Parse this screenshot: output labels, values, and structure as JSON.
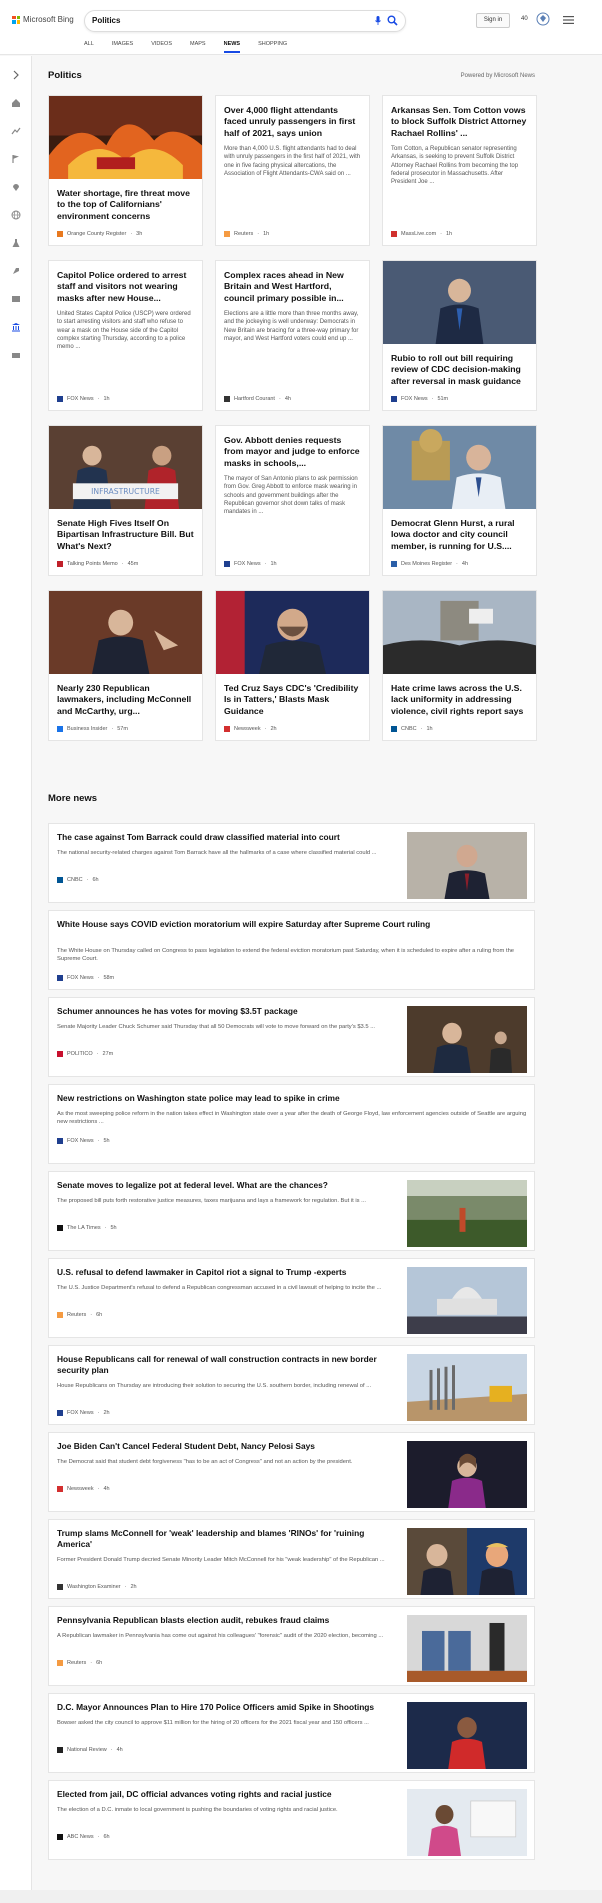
{
  "header": {
    "logo_text": "Microsoft Bing",
    "search_value": "Politics",
    "signin_label": "Sign in",
    "points": "40",
    "tabs": [
      {
        "label": "ALL"
      },
      {
        "label": "IMAGES"
      },
      {
        "label": "VIDEOS"
      },
      {
        "label": "MAPS"
      },
      {
        "label": "NEWS"
      },
      {
        "label": "SHOPPING"
      }
    ],
    "active_tab": "NEWS"
  },
  "rail_icons": [
    "collapse-arrow-icon",
    "home-icon",
    "trending-icon",
    "flag-icon",
    "location-pin-icon",
    "globe-icon",
    "science-icon",
    "rocket-icon",
    "film-icon",
    "politics-building-icon",
    "money-icon"
  ],
  "section": {
    "title": "Politics",
    "powered_by": "Powered by Microsoft News"
  },
  "cards": [
    {
      "title": "Water shortage, fire threat move to the top of Californians' environment concerns",
      "desc": "",
      "source": "Orange County Register",
      "time": "3h",
      "image": "wildfire",
      "source_color": "#e8791f"
    },
    {
      "title": "Over 4,000 flight attendants faced unruly passengers in first half of 2021, says union",
      "desc": "More than 4,000 U.S. flight attendants had to deal with unruly passengers in the first half of 2021, with one in five facing physical altercations, the Association of Flight Attendants-CWA said on ...",
      "source": "Reuters",
      "time": "1h",
      "image": "",
      "source_color": "#f59b42"
    },
    {
      "title": "Arkansas Sen. Tom Cotton vows to block Suffolk District Attorney Rachael Rollins' ...",
      "desc": "Tom Cotton, a Republican senator representing Arkansas, is seeking to prevent Suffolk District Attorney Rachael Rollins from becoming the top federal prosecutor in Massachusetts. After President Joe ...",
      "source": "MassLive.com",
      "time": "1h",
      "image": "",
      "source_color": "#d0312d"
    },
    {
      "title": "Capitol Police ordered to arrest staff and visitors not wearing masks after new House...",
      "desc": "United States Capitol Police (USCP) were ordered to start arresting visitors and staff who refuse to wear a mask on the House side of the Capitol complex starting Thursday, according to a police memo ...",
      "source": "FOX News",
      "time": "1h",
      "image": "",
      "source_color": "#1f3f8f"
    },
    {
      "title": "Complex races ahead in New Britain and West Hartford, council primary possible in...",
      "desc": "Elections are a little more than three months away, and the jockeying is well underway: Democrats in New Britain are bracing for a three-way primary for mayor, and West Hartford voters could end up ...",
      "source": "Hartford Courant",
      "time": "4h",
      "image": "",
      "source_color": "#333333"
    },
    {
      "title": "Rubio to roll out bill requiring review of CDC decision-making after reversal in mask guidance",
      "desc": "",
      "source": "FOX News",
      "time": "51m",
      "image": "rubio",
      "source_color": "#1f3f8f"
    },
    {
      "title": "Senate High Fives Itself On Bipartisan Infrastructure Bill. But What's Next?",
      "desc": "",
      "source": "Talking Points Memo",
      "time": "45m",
      "image": "infrastructure",
      "source_color": "#c0202a"
    },
    {
      "title": "Gov. Abbott denies requests from mayor and judge to enforce masks in schools,...",
      "desc": "The mayor of San Antonio plans to ask permission from Gov. Greg Abbott to enforce mask wearing in schools and government buildings after the Republican governor shot down talks of mask mandates in ...",
      "source": "FOX News",
      "time": "1h",
      "image": "",
      "source_color": "#1f3f8f"
    },
    {
      "title": "Democrat Glenn Hurst, a rural Iowa doctor and city council member, is running for U.S....",
      "desc": "",
      "source": "Des Moines Register",
      "time": "4h",
      "image": "hurst",
      "source_color": "#2a5fa8"
    },
    {
      "title": "Nearly 230 Republican lawmakers, including McConnell and McCarthy, urg...",
      "desc": "",
      "source": "Business Insider",
      "time": "57m",
      "image": "mcconnell",
      "source_color": "#1a73e8"
    },
    {
      "title": "Ted Cruz Says CDC's 'Credibility Is in Tatters,' Blasts Mask Guidance",
      "desc": "",
      "source": "Newsweek",
      "time": "2h",
      "image": "cruz",
      "source_color": "#d32f2f"
    },
    {
      "title": "Hate crime laws across the U.S. lack uniformity in addressing violence, civil rights report says",
      "desc": "",
      "source": "CNBC",
      "time": "1h",
      "image": "protest",
      "source_color": "#005594"
    }
  ],
  "more_news": {
    "title": "More news",
    "items": [
      {
        "title": "The case against Tom Barrack could draw classified material into court",
        "desc": "The national security-related charges against Tom Barrack have all the hallmarks of a case where classified material could ...",
        "source": "CNBC",
        "time": "6h",
        "image": "barrack",
        "source_color": "#005594"
      },
      {
        "title": "White House says COVID eviction moratorium will expire Saturday after Supreme Court ruling",
        "desc": "The White House on Thursday called on Congress to pass legislation to extend the federal eviction moratorium past Saturday, when it is scheduled to expire after a ruling from the Supreme Court.",
        "source": "FOX News",
        "time": "58m",
        "image": "",
        "source_color": "#1f3f8f"
      },
      {
        "title": "Schumer announces he has votes for moving $3.5T package",
        "desc": "Senate Majority Leader Chuck Schumer said Thursday that all 50 Democrats will vote to move forward on the party's $3.5 ...",
        "source": "POLITICO",
        "time": "27m",
        "image": "schumer",
        "source_color": "#c8102e"
      },
      {
        "title": "New restrictions on Washington state police may lead to spike in crime",
        "desc": "As the most sweeping police reform in the nation takes effect in Washington state over a year after the death of George Floyd, law enforcement agencies outside of Seattle are arguing new restrictions ...",
        "source": "FOX News",
        "time": "5h",
        "image": "",
        "source_color": "#1f3f8f"
      },
      {
        "title": "Senate moves to legalize pot at federal level. What are the chances?",
        "desc": "The proposed bill puts forth restorative justice measures, taxes marijuana and lays a framework for regulation. But it is ...",
        "source": "The LA Times",
        "time": "5h",
        "image": "greenhouse",
        "source_color": "#111111"
      },
      {
        "title": "U.S. refusal to defend lawmaker in Capitol riot a signal to Trump -experts",
        "desc": "The U.S. Justice Department's refusal to defend a Republican congressman accused in a civil lawsuit of helping to incite the ...",
        "source": "Reuters",
        "time": "6h",
        "image": "capitol",
        "source_color": "#f59b42"
      },
      {
        "title": "House Republicans call for renewal of wall construction contracts in new border security plan",
        "desc": "House Republicans on Thursday are introducing their solution to securing the U.S. southern border, including renewal of ...",
        "source": "FOX News",
        "time": "2h",
        "image": "wall",
        "source_color": "#1f3f8f"
      },
      {
        "title": "Joe Biden Can't Cancel Federal Student Debt, Nancy Pelosi Says",
        "desc": "The Democrat said that student debt forgiveness \"has to be an act of Congress\" and not an action by the president.",
        "source": "Newsweek",
        "time": "4h",
        "image": "pelosi",
        "source_color": "#d32f2f"
      },
      {
        "title": "Trump slams McConnell for 'weak' leadership and blames 'RINOs' for 'ruining America'",
        "desc": "Former President Donald Trump decried Senate Minority Leader Mitch McConnell for his \"weak leadership\" of the Republican ...",
        "source": "Washington Examiner",
        "time": "2h",
        "image": "trump",
        "source_color": "#333333"
      },
      {
        "title": "Pennsylvania Republican blasts election audit, rebukes fraud claims",
        "desc": "A Republican lawmaker in Pennsylvania has come out against his colleagues' \"forensic\" audit of the 2020 election, becoming ...",
        "source": "Reuters",
        "time": "6h",
        "image": "booths",
        "source_color": "#f59b42"
      },
      {
        "title": "D.C. Mayor Announces Plan to Hire 170 Police Officers amid Spike in Shootings",
        "desc": "Bowser asked the city council to approve $11 million for the hiring of 20 officers for the 2021 fiscal year and 150 officers ...",
        "source": "National Review",
        "time": "4h",
        "image": "bowser",
        "source_color": "#222222"
      },
      {
        "title": "Elected from jail, DC official advances voting rights and racial justice",
        "desc": "The election of a D.C. inmate to local government is pushing the boundaries of voting rights and racial justice.",
        "source": "ABC News",
        "time": "6h",
        "image": "official",
        "source_color": "#111111"
      }
    ]
  }
}
